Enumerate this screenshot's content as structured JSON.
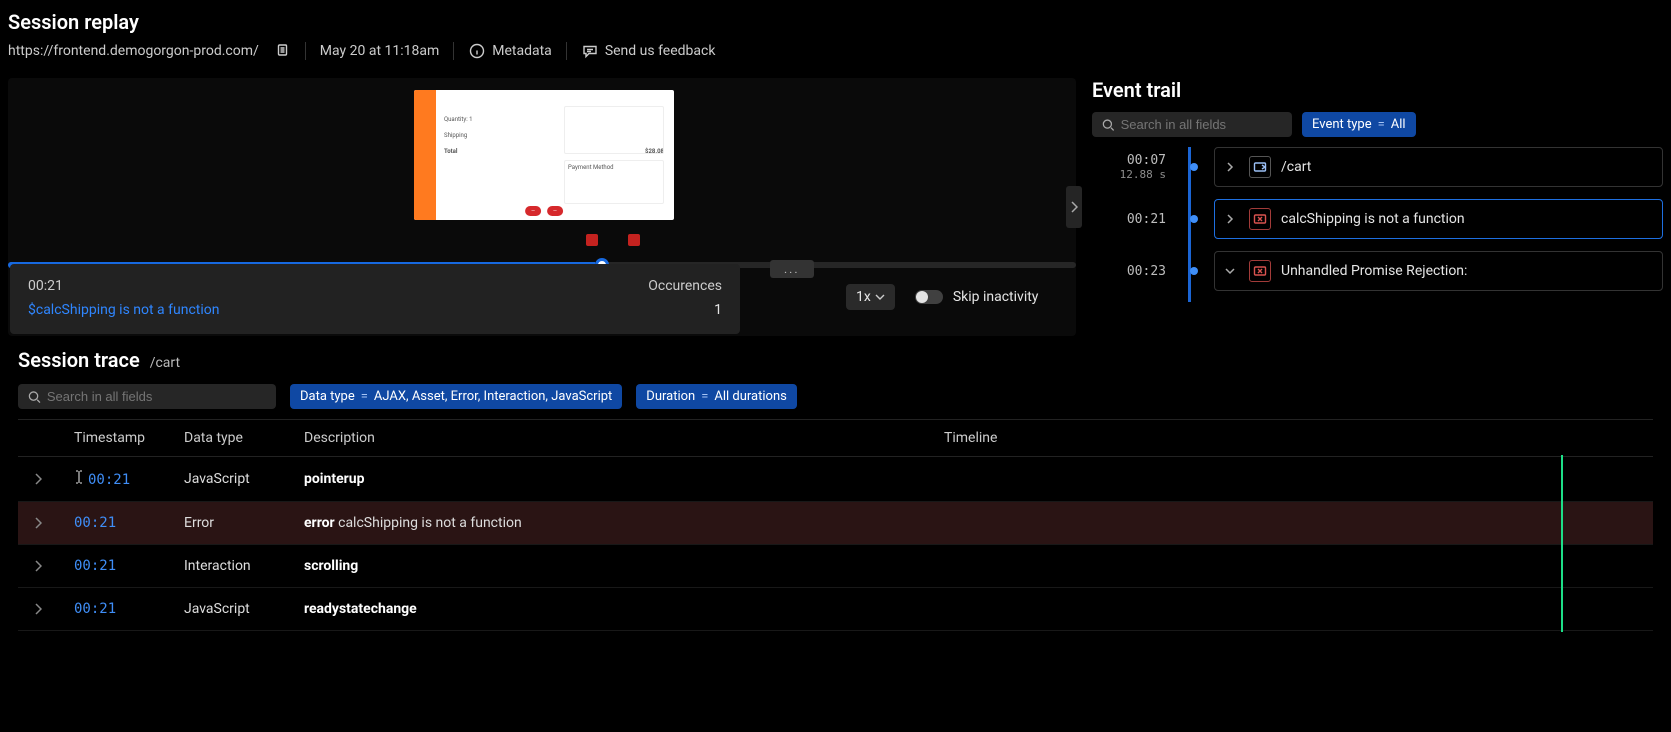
{
  "header": {
    "title": "Session replay",
    "url": "https://frontend.demogorgon-prod.com/",
    "timestamp": "May 20 at 11:18am",
    "metadata_label": "Metadata",
    "feedback_label": "Send us feedback"
  },
  "player": {
    "thumb_rows": {
      "shipping": "Shipping",
      "total_label": "Total",
      "total_value": "$28.08",
      "payment_title": "Payment Method",
      "qty_label": "Quantity: 1"
    },
    "tooltip": {
      "time": "00:21",
      "occur_label": "Occurences",
      "error": "$calcShipping is not a function",
      "count": "1"
    },
    "speed_label": "1x",
    "skip_label": "Skip inactivity",
    "more": "..."
  },
  "trail": {
    "title": "Event trail",
    "search_placeholder": "Search in all fields",
    "filter_label": "Event type",
    "filter_value": "All",
    "items": [
      {
        "time": "00:07",
        "dur": "12.88 s",
        "kind": "route",
        "label": "/cart",
        "selected": false,
        "expand": "right"
      },
      {
        "time": "00:21",
        "dur": "",
        "kind": "error",
        "label": "calcShipping is not a function",
        "selected": true,
        "expand": "right"
      },
      {
        "time": "00:23",
        "dur": "",
        "kind": "error",
        "label": "Unhandled Promise Rejection:",
        "selected": false,
        "expand": "down"
      }
    ]
  },
  "trace": {
    "title": "Session trace",
    "crumb": "/cart",
    "search_placeholder": "Search in all fields",
    "filter_type_label": "Data type",
    "filter_type_value": "AJAX, Asset, Error, Interaction, JavaScript",
    "filter_dur_label": "Duration",
    "filter_dur_value": "All durations",
    "columns": {
      "ts": "Timestamp",
      "dt": "Data type",
      "desc": "Description",
      "tl": "Timeline"
    },
    "rows": [
      {
        "ts": "00:21",
        "dt": "JavaScript",
        "desc_strong": "pointerup",
        "desc_rest": "",
        "is_error": false,
        "ibeam": true
      },
      {
        "ts": "00:21",
        "dt": "Error",
        "desc_strong": "error",
        "desc_rest": " calcShipping is not a function",
        "is_error": true,
        "ibeam": false
      },
      {
        "ts": "00:21",
        "dt": "Interaction",
        "desc_strong": "scrolling",
        "desc_rest": "",
        "is_error": false,
        "ibeam": false
      },
      {
        "ts": "00:21",
        "dt": "JavaScript",
        "desc_strong": "readystatechange",
        "desc_rest": "",
        "is_error": false,
        "ibeam": false
      }
    ]
  }
}
